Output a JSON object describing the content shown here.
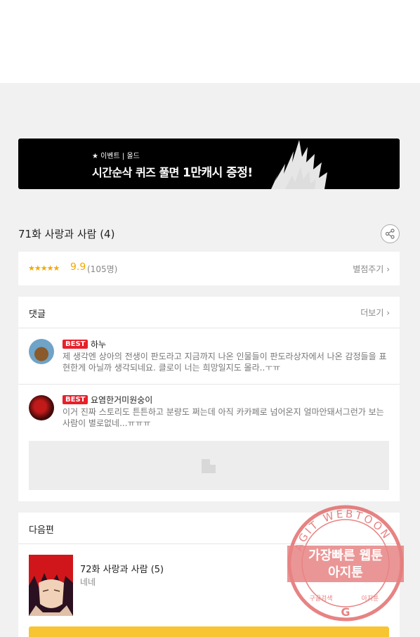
{
  "banner": {
    "small_text": "★ 이벤트 | 올드",
    "main_text": "시간순삭 퀴즈 풀면",
    "highlight_text": "1만캐시 증정!"
  },
  "episode": {
    "title": "71화 사랑과 사람 (4)",
    "share_icon": "share-icon"
  },
  "rating": {
    "stars": "★★★★★",
    "score": "9.9",
    "count": "(105명)",
    "rate_link": "별점주기"
  },
  "comments": {
    "header": "댓글",
    "more": "더보기",
    "items": [
      {
        "badge": "BEST",
        "nick": "하누",
        "text": "제 생각엔 상아의 전생이 판도라고 지금까지 나온 인물들이 판도라상자에서 나온 감정들을 표현한게 아닐까 생각되네요. 클로이 너는 희망일지도 몰라..ㅜㅠ"
      },
      {
        "badge": "BEST",
        "nick": "요염한거미원숭이",
        "text": "이거 진짜 스토리도 튼튼하고 분량도 쩌는데 아직 카카페로 넘어온지 얼마안돼서그런가 보는사람이 별로없네...ㅠㅠㅠ"
      }
    ]
  },
  "next": {
    "header": "다음편",
    "title": "72화 사랑과 사람 (5)",
    "subtitle": "네네"
  },
  "stamp": {
    "ring_text": "AGIT WEBTOON",
    "line1": "가장빠른 웹툰",
    "line2": "아지툰",
    "bottom_left": "구글검색",
    "bottom_right": "아지툰"
  },
  "colors": {
    "accent": "#f5a800",
    "best_badge": "#e8202a",
    "next_button": "#f7c531",
    "stamp": "#e05a5a"
  }
}
